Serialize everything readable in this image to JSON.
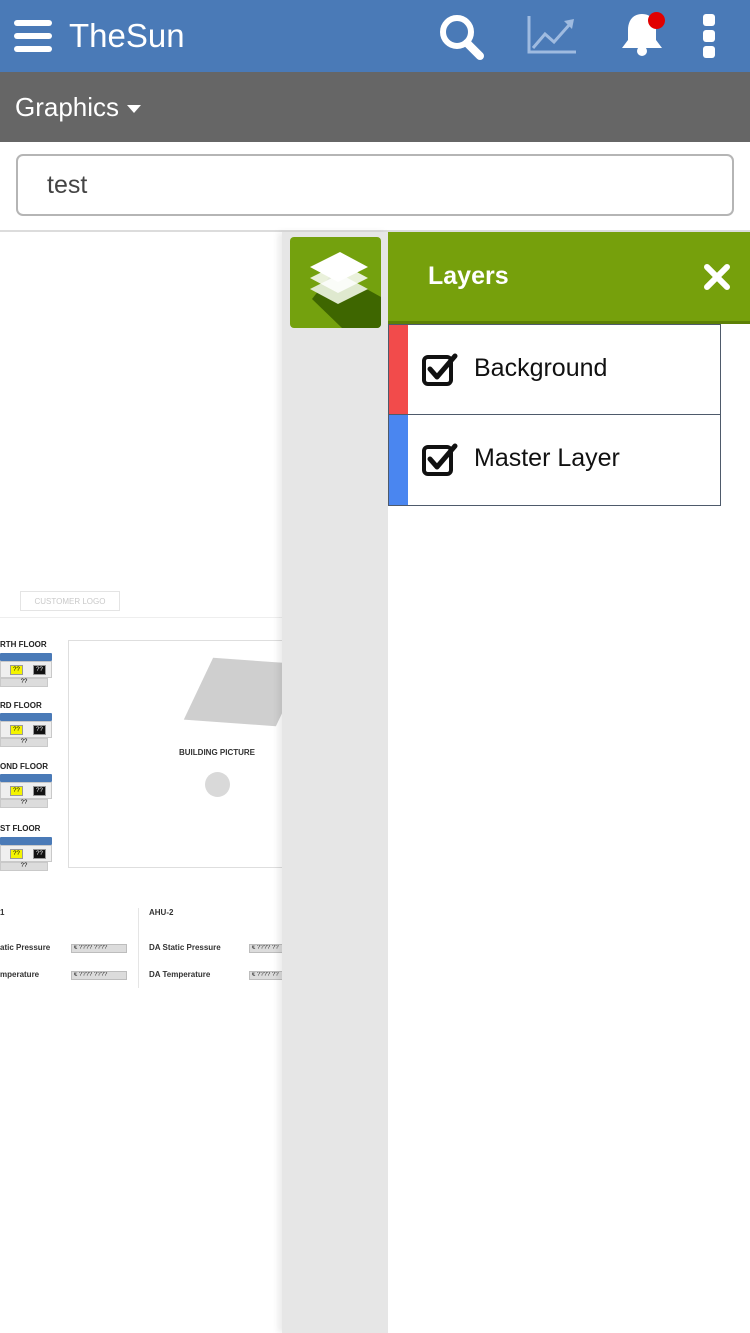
{
  "header": {
    "app_title": "TheSun",
    "notification_badge_color": "#e10000",
    "bar_color": "#4a7ab7"
  },
  "subheader": {
    "view_label": "Graphics"
  },
  "search": {
    "value": "test"
  },
  "canvas": {
    "logo_placeholder": "CUSTOMER LOGO",
    "floors": [
      {
        "label": "RTH FLOOR",
        "yellow": "??",
        "black": "??",
        "bottom": "??"
      },
      {
        "label": "RD FLOOR",
        "yellow": "??",
        "black": "??",
        "bottom": "??"
      },
      {
        "label": "OND FLOOR",
        "yellow": "??",
        "black": "??",
        "bottom": "??"
      },
      {
        "label": "ST FLOOR",
        "yellow": "??",
        "black": "??",
        "bottom": "??"
      }
    ],
    "building_label": "BUILDING PICTURE",
    "ahu_left": {
      "title": "1",
      "static_pressure_label": "atic Pressure",
      "static_pressure_value": "€ ???? ????",
      "temperature_label": "mperature",
      "temperature_value": "€ ???? ????"
    },
    "ahu_right": {
      "title": "AHU-2",
      "static_pressure_label": "DA Static Pressure",
      "static_pressure_value": "€ ???? ??",
      "temperature_label": "DA Temperature",
      "temperature_value": "€ ???? ??"
    }
  },
  "layers_panel": {
    "title": "Layers",
    "accent_color": "#76a00c",
    "layers": [
      {
        "name": "Background",
        "checked": true,
        "color": "#f24b4b"
      },
      {
        "name": "Master Layer",
        "checked": true,
        "color": "#4a86f0"
      }
    ]
  }
}
